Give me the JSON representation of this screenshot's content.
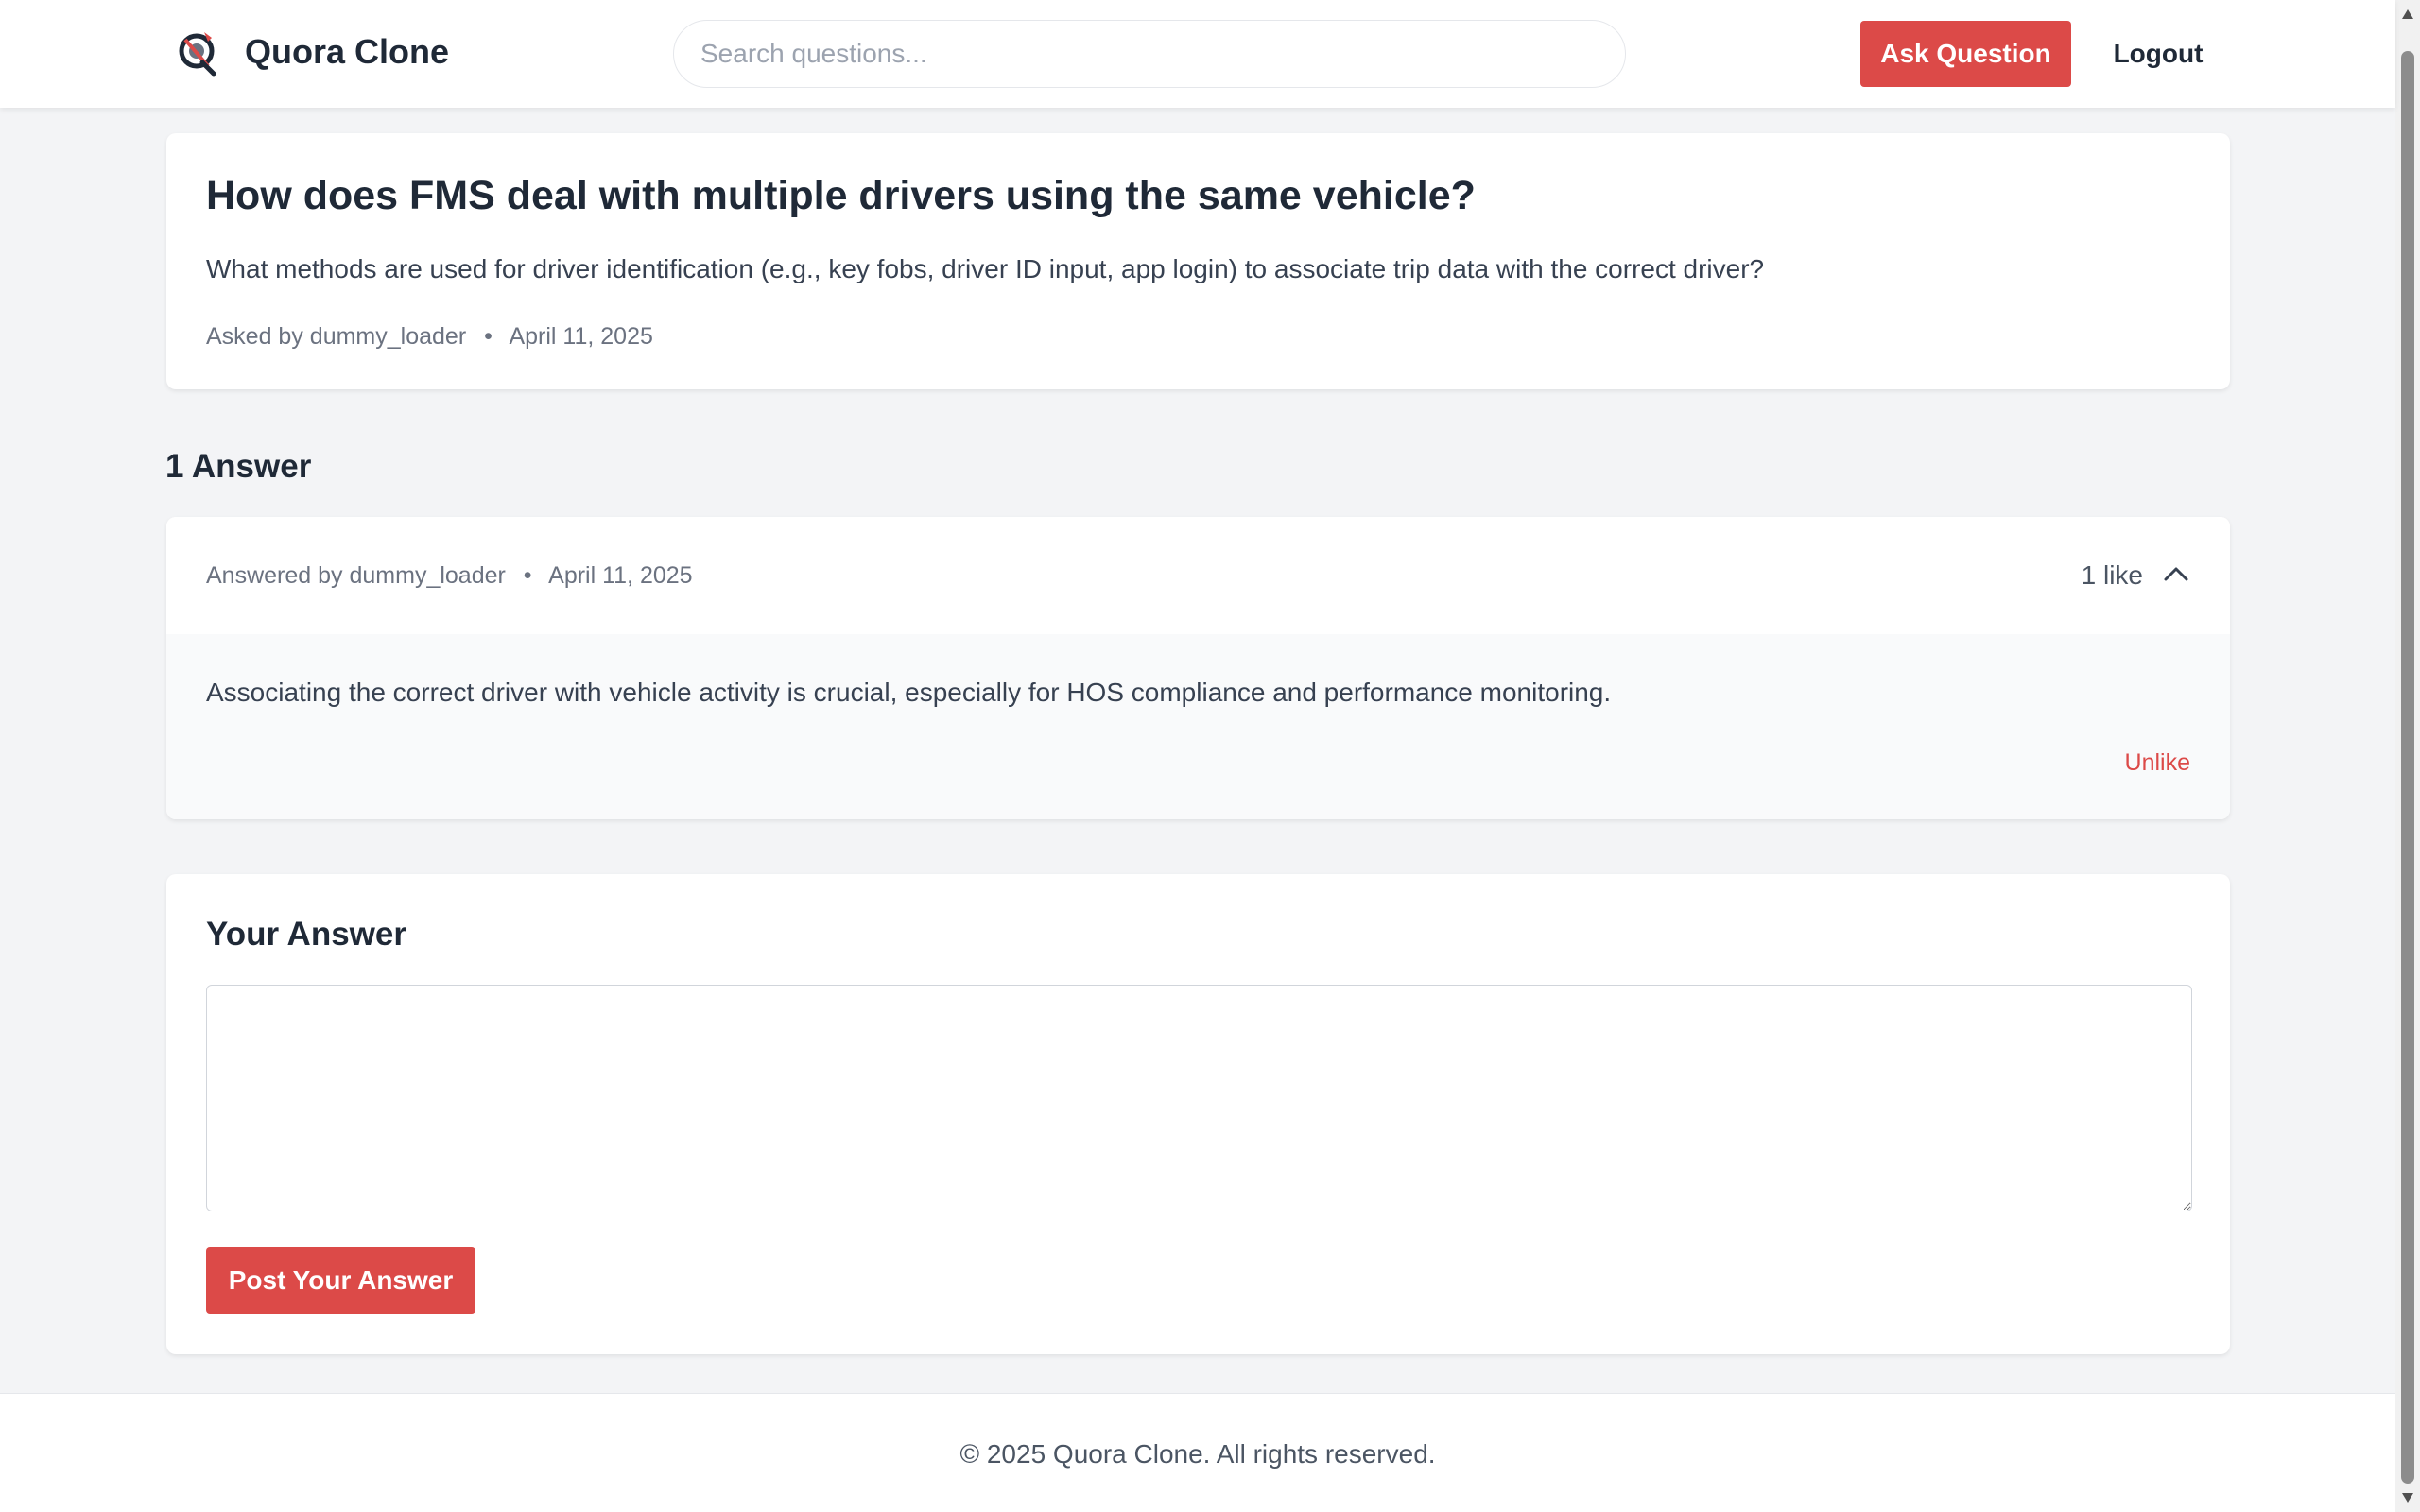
{
  "header": {
    "brand": "Quora Clone",
    "search_placeholder": "Search questions...",
    "ask_button": "Ask Question",
    "logout_button": "Logout"
  },
  "question": {
    "title": "How does FMS deal with multiple drivers using the same vehicle?",
    "body": "What methods are used for driver identification (e.g., key fobs, driver ID input, app login) to associate trip data with the correct driver?",
    "asked_by_prefix": "Asked by",
    "author": "dummy_loader",
    "separator": "•",
    "date": "April 11, 2025"
  },
  "answers": {
    "heading": "1 Answer",
    "items": [
      {
        "answered_by_prefix": "Answered by",
        "author": "dummy_loader",
        "separator": "•",
        "date": "April 11, 2025",
        "likes": "1 like",
        "text": "Associating the correct driver with vehicle activity is crucial, especially for HOS compliance and performance monitoring.",
        "unlike_label": "Unlike"
      }
    ]
  },
  "your_answer": {
    "title": "Your Answer",
    "textarea_value": "",
    "post_button": "Post Your Answer"
  },
  "footer": {
    "text": "© 2025 Quora Clone. All rights reserved."
  },
  "colors": {
    "accent": "#dc4a48",
    "background": "#f3f4f6",
    "text": "#1f2937"
  },
  "icons": {
    "logo": "quora-clone-logo",
    "collapse": "chevron-up-icon"
  }
}
